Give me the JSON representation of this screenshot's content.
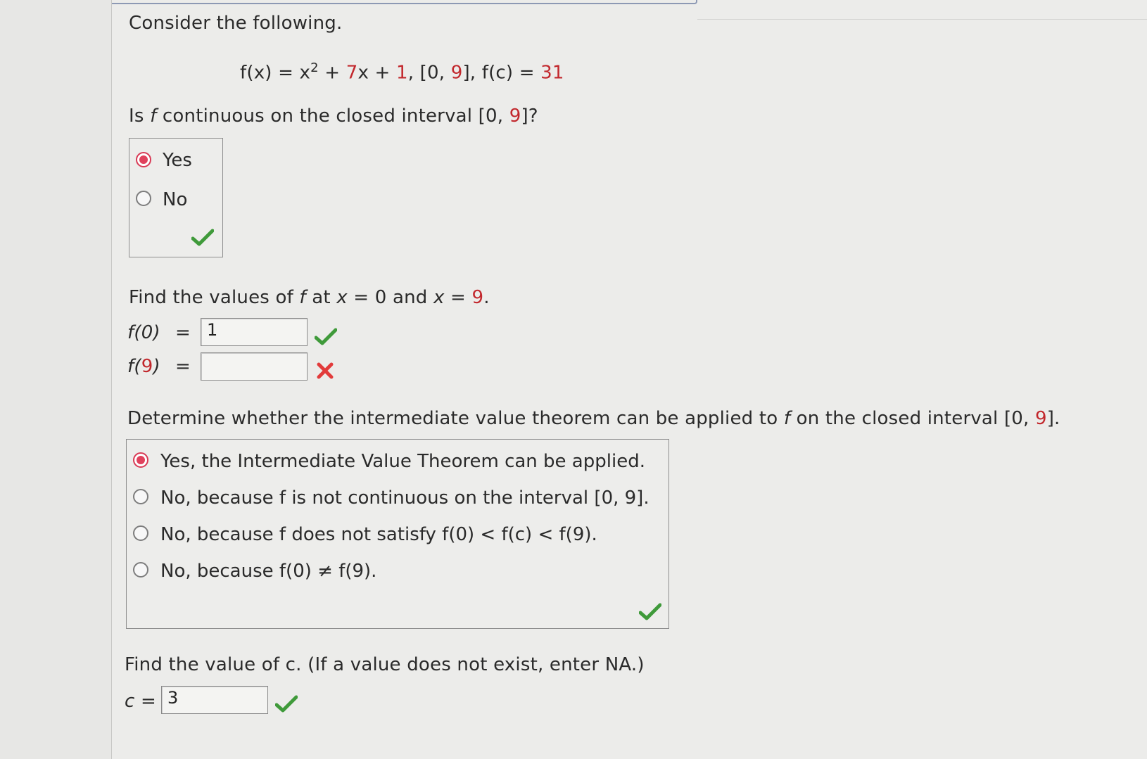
{
  "intro": "Consider the following.",
  "function": {
    "lhs": "f(x) = x",
    "exp": "2",
    "plus1": " + ",
    "coef": "7",
    "var": "x + ",
    "const": "1",
    "sep1": ", [0, ",
    "b": "9",
    "sep2": "], f(c) = ",
    "target": "31"
  },
  "q1": {
    "prefix": "Is ",
    "var": "f",
    "middle": " continuous on the closed interval [0, ",
    "b": "9",
    "suffix": "]?",
    "options": [
      "Yes",
      "No"
    ],
    "selected": 0
  },
  "q2": {
    "prefix": "Find the values of ",
    "var": "f",
    "at": " at ",
    "x": "x",
    "eq0": " = 0 and ",
    "x2": "x",
    "eq9": " = ",
    "b": "9",
    "dot": ".",
    "f0_label": "f(0)",
    "f9_prefix": "f(",
    "f9_b": "9",
    "f9_suffix": ")",
    "eq": "=",
    "f0_value": "1",
    "f9_value": ""
  },
  "q3": {
    "prefix": "Determine whether the intermediate value theorem can be applied to ",
    "var": "f",
    "middle": " on the closed interval [0, ",
    "b": "9",
    "suffix": "].",
    "options": [
      "Yes, the Intermediate Value Theorem can be applied.",
      "No, because f is not continuous on the interval [0, 9].",
      "No, because f does not satisfy f(0) < f(c) < f(9).",
      "No, because f(0) ≠ f(9)."
    ],
    "selected": 0
  },
  "q4": {
    "prompt": "Find the value of c. (If a value does not exist, enter NA.)",
    "label": "c =",
    "value": "3"
  },
  "colors": {
    "accent_red": "#c2282d",
    "check_green": "#3f9a3a",
    "cross_red": "#e23b3b",
    "radio_selected": "#e0415c"
  },
  "icons": {
    "correct": "check-icon",
    "incorrect": "cross-icon"
  }
}
